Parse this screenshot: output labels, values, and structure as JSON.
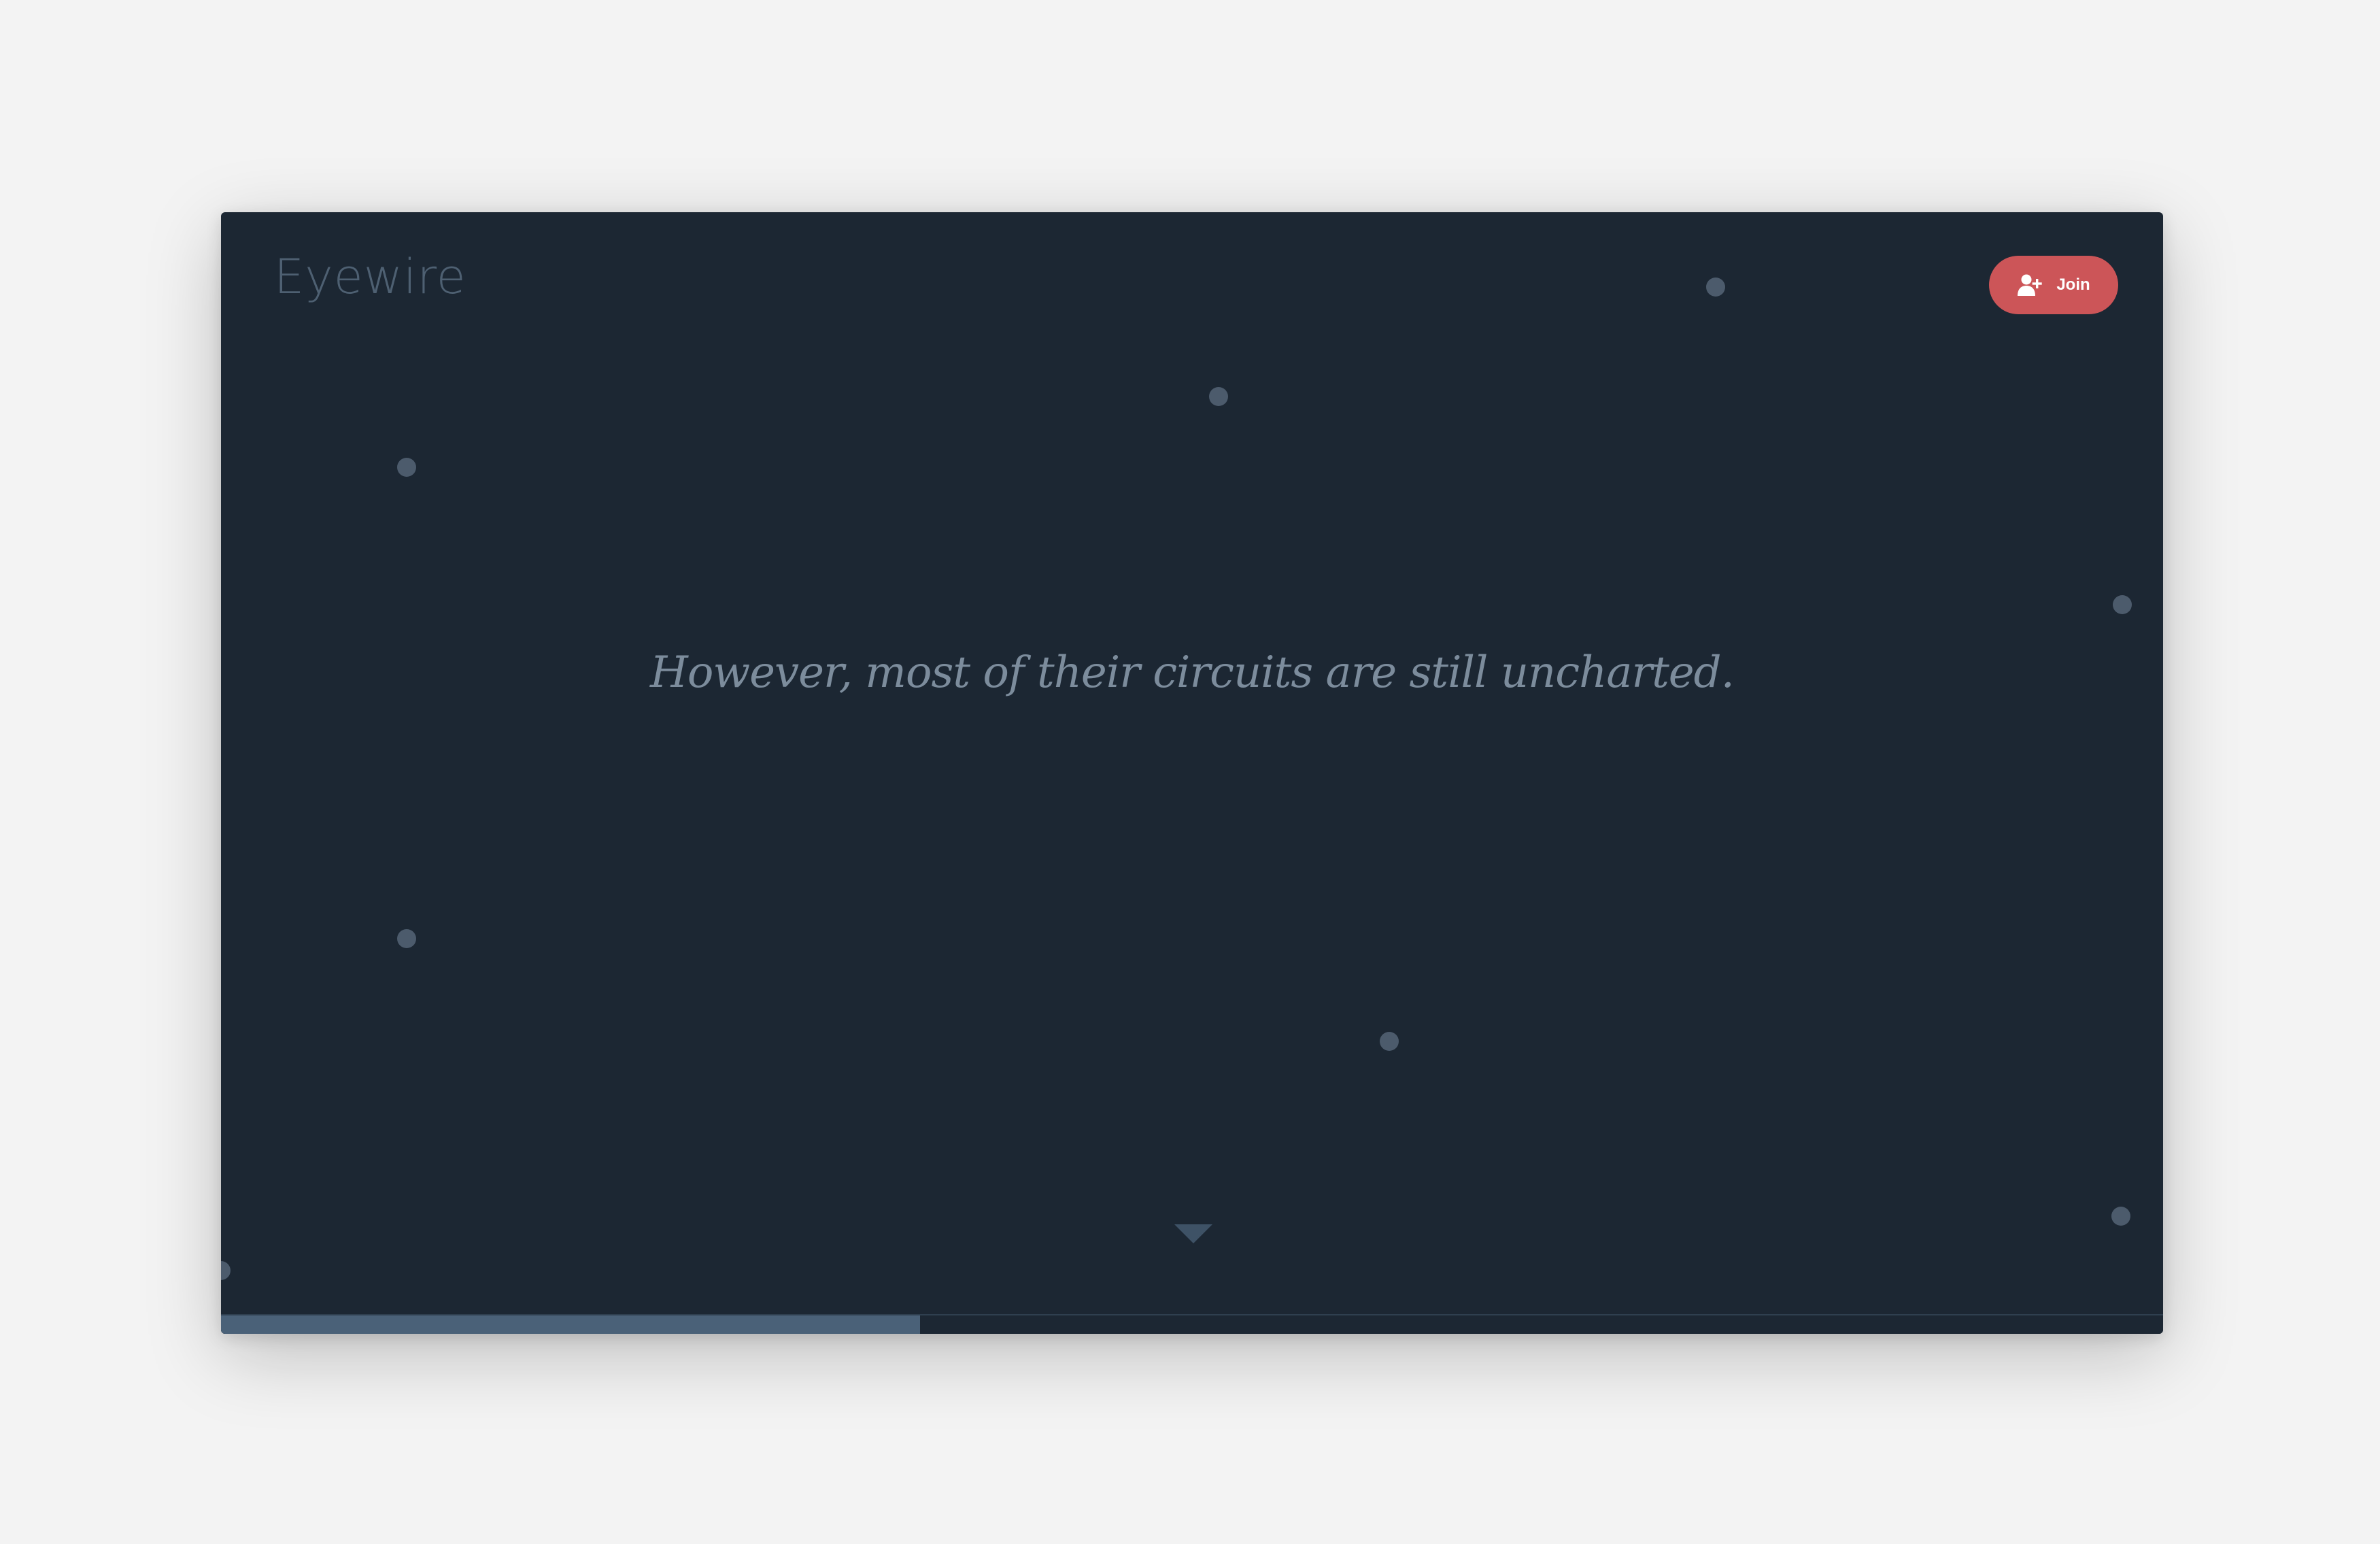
{
  "header": {
    "logo_text": "Eyewire",
    "join_label": "Join",
    "join_icon": "user-plus-icon"
  },
  "main": {
    "headline": "However, most of their circuits are still uncharted."
  },
  "scroll_indicator": {
    "icon": "caret-down-icon"
  },
  "progress": {
    "fraction": 0.36
  },
  "colors": {
    "background": "#1c2733",
    "accent": "#cc5558",
    "dots": "#4c5b6c",
    "progress_fill": "#4a6178"
  }
}
